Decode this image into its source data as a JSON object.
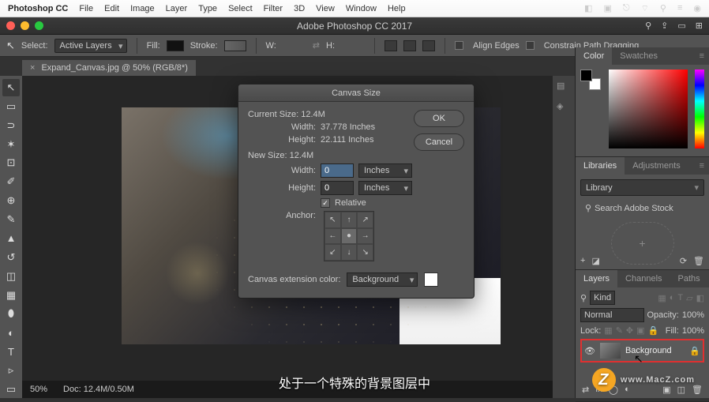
{
  "menubar": {
    "app": "Photoshop CC",
    "items": [
      "File",
      "Edit",
      "Image",
      "Layer",
      "Type",
      "Select",
      "Filter",
      "3D",
      "View",
      "Window",
      "Help"
    ],
    "right_icons": [
      "◧",
      "▣",
      "⎋",
      "⌂",
      "◇",
      "⚲",
      "≡",
      "●"
    ]
  },
  "window": {
    "title": "Adobe Photoshop CC 2017"
  },
  "options": {
    "select_label": "Select:",
    "select_value": "Active Layers",
    "fill_label": "Fill:",
    "stroke_label": "Stroke:",
    "w_label": "W:",
    "h_label": "H:",
    "align_label": "Align Edges",
    "constrain_label": "Constrain Path Dragging"
  },
  "doc_tab": {
    "name": "Expand_Canvas.jpg @ 50% (RGB/8*)",
    "close": "×"
  },
  "tools": [
    "↖",
    "▭",
    "⊡",
    "◐",
    "✂",
    "✐",
    "⌖",
    "⇄",
    "◔",
    "✎",
    "⌫",
    "◧",
    "T",
    "▹",
    "⬚",
    "✋",
    "⚲"
  ],
  "panels": {
    "color": {
      "tabs": [
        "Color",
        "Swatches"
      ]
    },
    "libraries": {
      "tabs": [
        "Libraries",
        "Adjustments"
      ],
      "dropdown": "Library",
      "search": "Search Adobe Stock"
    },
    "layers": {
      "tabs": [
        "Layers",
        "Channels",
        "Paths"
      ],
      "kind": "Kind",
      "mode": "Normal",
      "opacity_label": "Opacity:",
      "opacity_value": "100%",
      "lock_label": "Lock:",
      "fill_label": "Fill:",
      "fill_value": "100%",
      "layer_name": "Background"
    }
  },
  "dialog": {
    "title": "Canvas Size",
    "ok": "OK",
    "cancel": "Cancel",
    "current_label": "Current Size:",
    "current_size": "12.4M",
    "cur_width_label": "Width:",
    "cur_width": "37.778 Inches",
    "cur_height_label": "Height:",
    "cur_height": "22.111 Inches",
    "new_label": "New Size:",
    "new_size": "12.4M",
    "width_label": "Width:",
    "width_value": "0",
    "width_unit": "Inches",
    "height_label": "Height:",
    "height_value": "0",
    "height_unit": "Inches",
    "relative_label": "Relative",
    "anchor_label": "Anchor:",
    "extension_label": "Canvas extension color:",
    "extension_value": "Background"
  },
  "status": {
    "zoom": "50%",
    "doc": "Doc: 12.4M/0.50M"
  },
  "caption": "处于一个特殊的背景图层中",
  "watermark": "www.MacZ.com"
}
